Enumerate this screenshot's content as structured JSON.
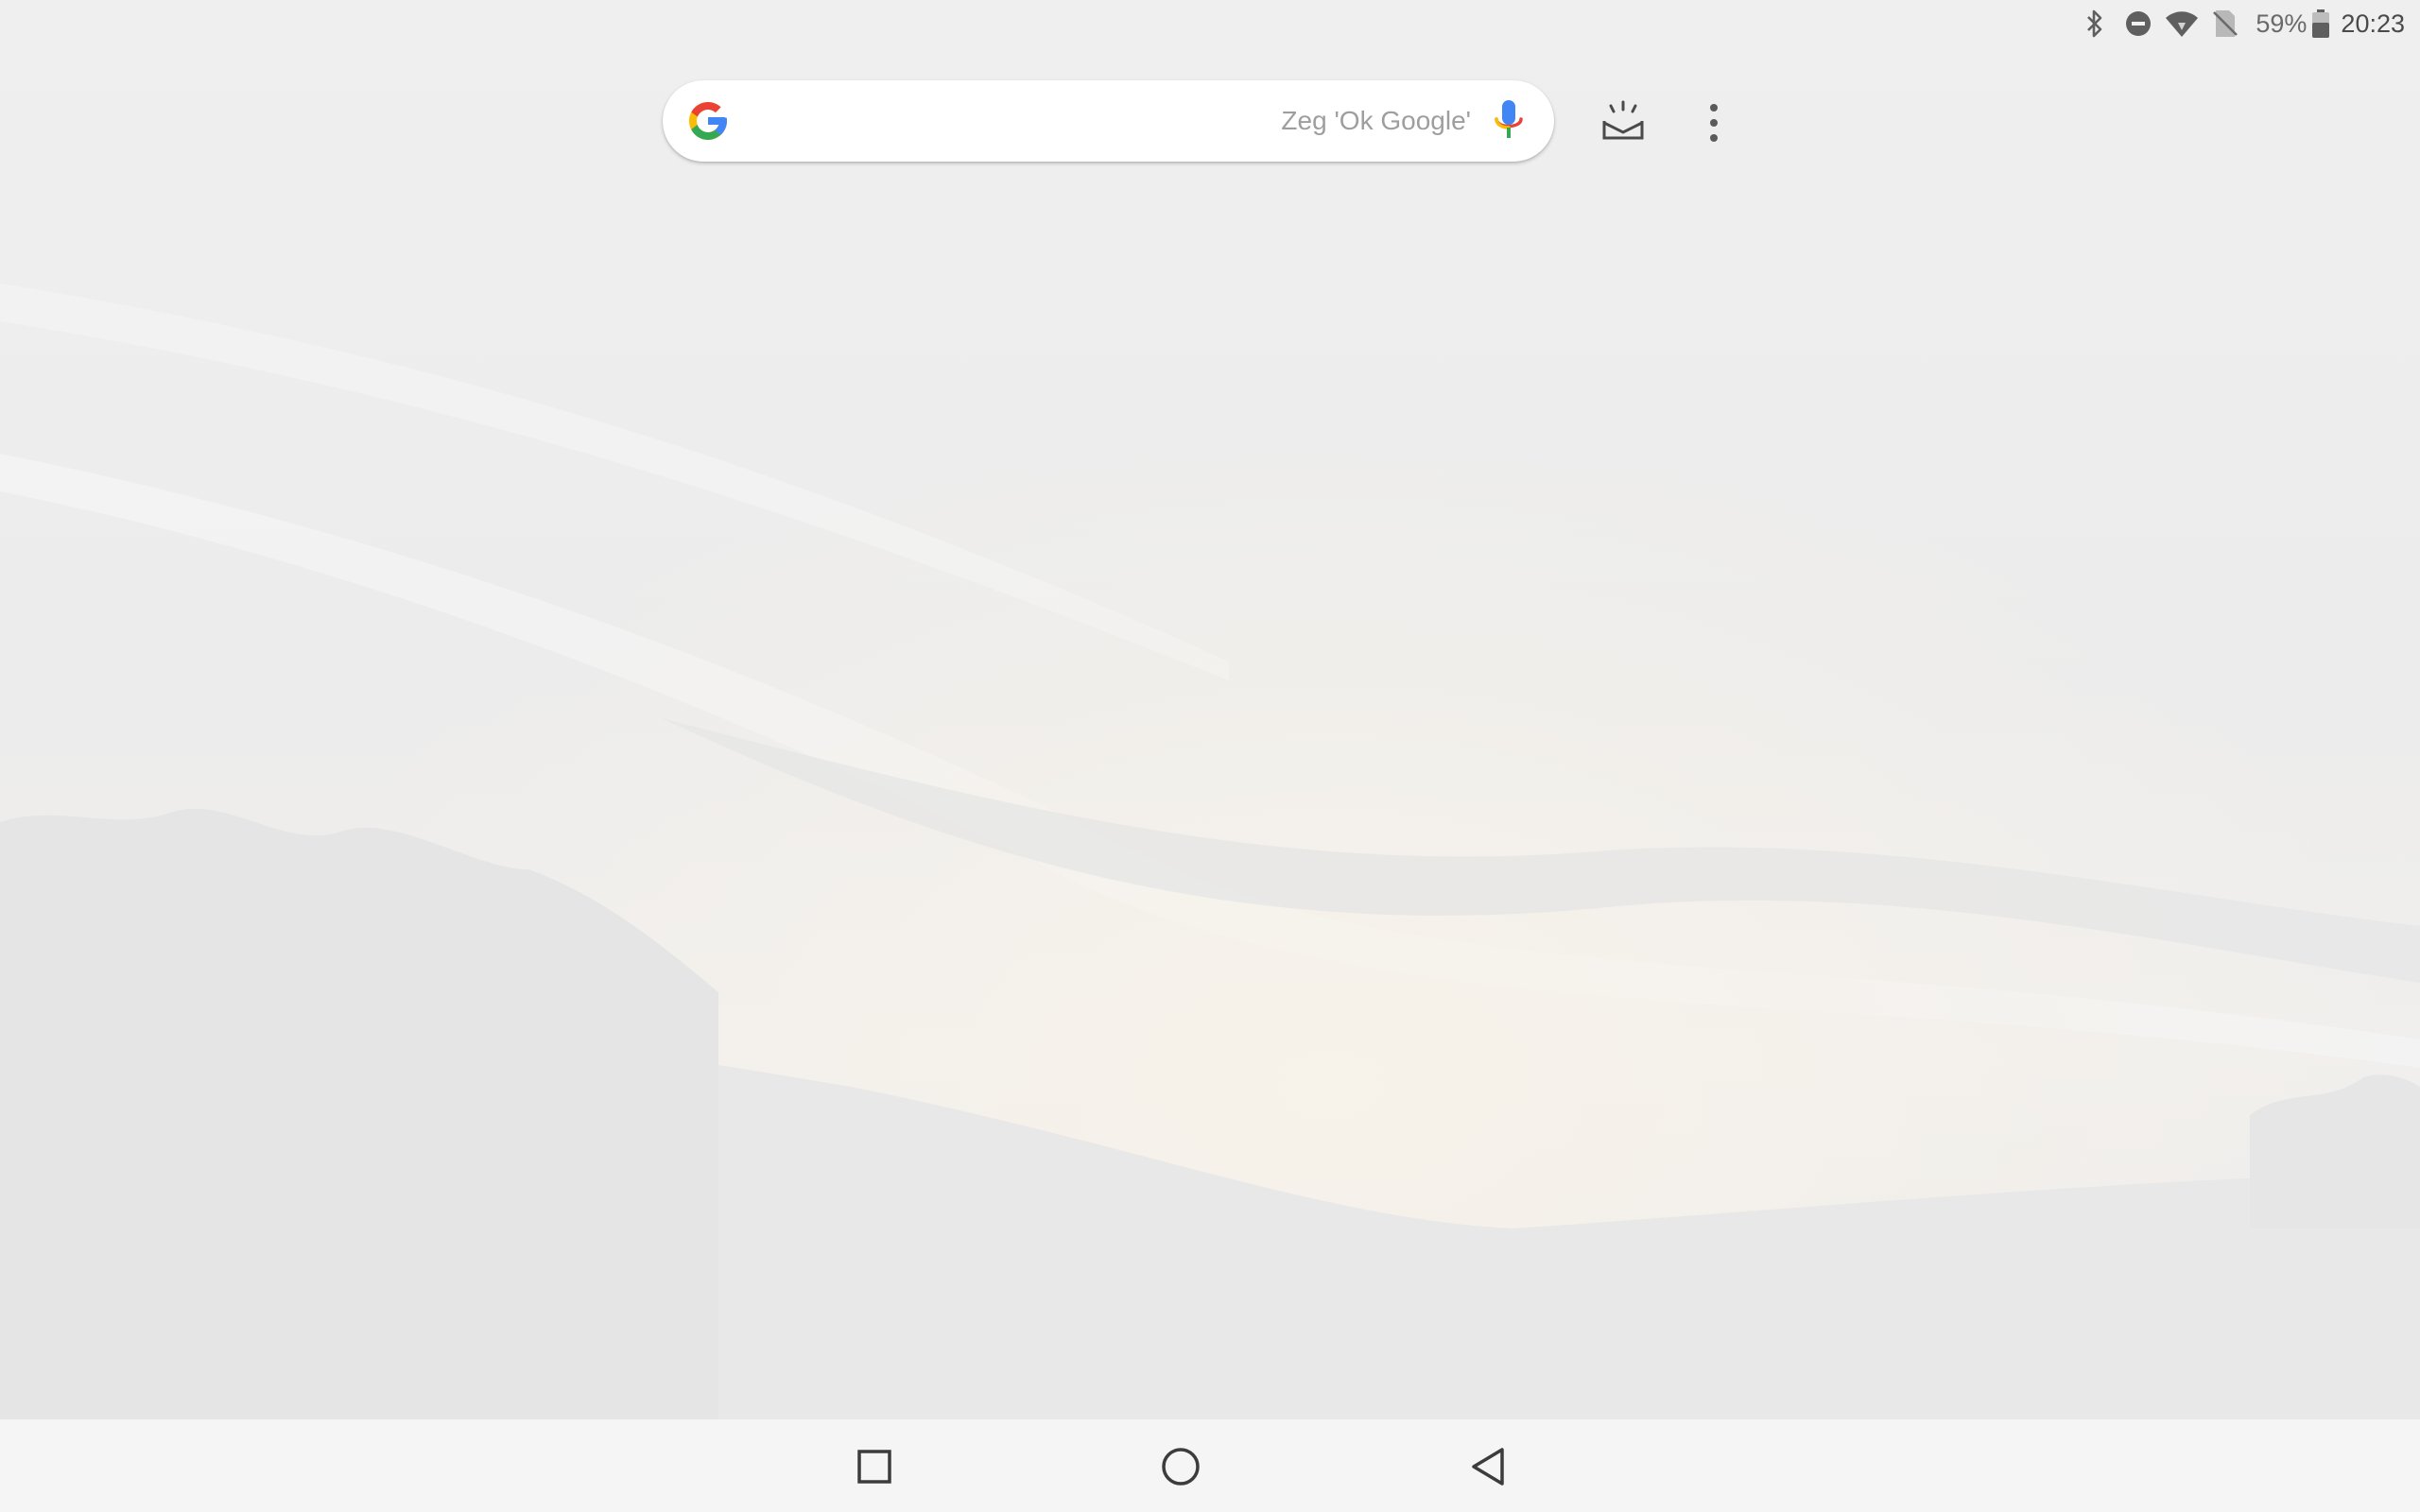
{
  "status_bar": {
    "icons": [
      "bluetooth-icon",
      "do-not-disturb-icon",
      "wifi-icon",
      "no-sim-icon",
      "battery-icon"
    ],
    "battery_percent": "59%",
    "time": "20:23"
  },
  "search": {
    "logo": "google-g-logo",
    "hint": "Zeg 'Ok Google'",
    "mic_icon": "microphone-icon"
  },
  "top_actions": {
    "discover_icon": "inbox-sparkle-icon",
    "menu_icon": "more-vert-icon"
  },
  "nav_bar": {
    "buttons": [
      "recents-square-icon",
      "home-circle-icon",
      "back-triangle-icon"
    ]
  },
  "colors": {
    "google_blue": "#4285F4",
    "google_red": "#EA4335",
    "google_yellow": "#FBBC05",
    "google_green": "#34A853",
    "nav_icon": "#3c3c3c",
    "status_icon": "#5f5f5f"
  }
}
